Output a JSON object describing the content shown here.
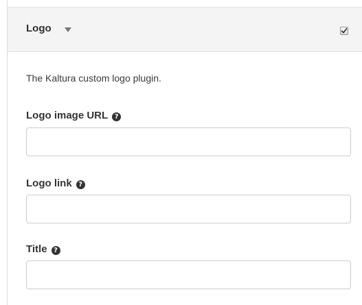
{
  "panel": {
    "title": "Logo",
    "enabled": true,
    "description": "The Kaltura custom logo plugin."
  },
  "fields": {
    "logo_image_url": {
      "label": "Logo image URL",
      "value": "",
      "placeholder": ""
    },
    "logo_link": {
      "label": "Logo link",
      "value": "",
      "placeholder": ""
    },
    "title": {
      "label": "Title",
      "value": "",
      "placeholder": ""
    }
  },
  "icons": {
    "header_caret": "caret-down-icon",
    "help": "question-circle-icon",
    "checkbox": "checkmark-icon"
  },
  "help_glyph": "?"
}
